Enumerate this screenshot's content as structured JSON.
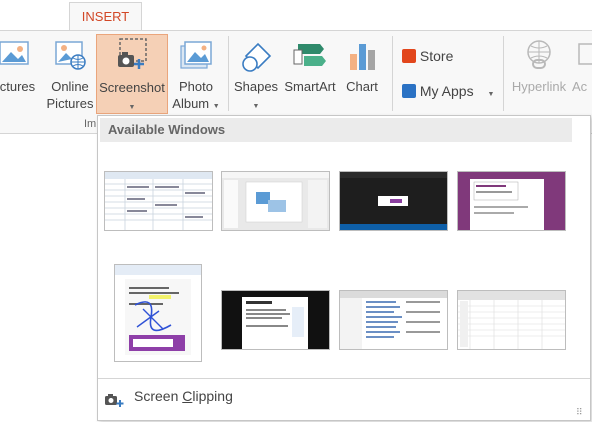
{
  "tabs": {
    "active": "INSERT"
  },
  "ribbon": {
    "pictures_label": "ictures",
    "online_pictures_label": [
      "Online",
      "Pictures"
    ],
    "screenshot_label": "Screenshot",
    "photo_album_label": [
      "Photo",
      "Album"
    ],
    "shapes_label": "Shapes",
    "smartart_label": "SmartArt",
    "chart_label": "Chart",
    "store_label": "Store",
    "my_apps_label": "My Apps",
    "hyperlink_label": "Hyperlink",
    "action_label": "Ac",
    "group_label_partial": "Im",
    "colors": {
      "accent": "#d24726",
      "selected_bg": "#f5d0b6",
      "selected_border": "#eaa57c"
    }
  },
  "dropdown": {
    "header": "Available Windows",
    "thumbnails": [
      {
        "name": "excel-sheet-window"
      },
      {
        "name": "powerpoint-window"
      },
      {
        "name": "dark-window"
      },
      {
        "name": "onenote-window"
      },
      {
        "name": "paint-window"
      },
      {
        "name": "webpage-window"
      },
      {
        "name": "file-explorer-window"
      },
      {
        "name": "spreadsheet-window"
      }
    ],
    "screen_clipping_label_pre": "Screen ",
    "screen_clipping_label_ul": "C",
    "screen_clipping_label_post": "lipping"
  }
}
